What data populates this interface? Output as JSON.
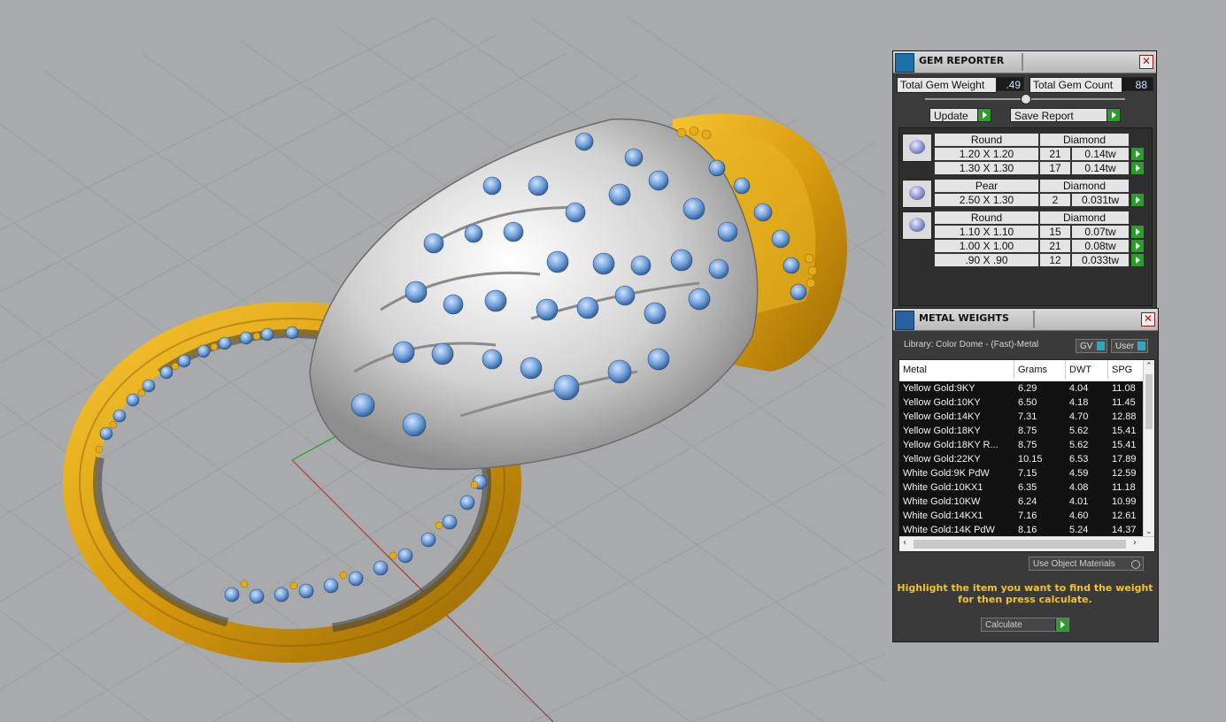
{
  "gem_reporter": {
    "title": "GEM REPORTER",
    "total_gem_weight_label": "Total Gem Weight",
    "total_gem_weight_value": ".49",
    "total_gem_count_label": "Total Gem Count",
    "total_gem_count_value": "88",
    "update_label": "Update",
    "save_report_label": "Save Report",
    "groups": [
      {
        "shape": "Round",
        "material": "Diamond",
        "rows": [
          {
            "size": "1.20 X 1.20",
            "count": "21",
            "weight": "0.14tw"
          },
          {
            "size": "1.30 X 1.30",
            "count": "17",
            "weight": "0.14tw"
          }
        ]
      },
      {
        "shape": "Pear",
        "material": "Diamond",
        "rows": [
          {
            "size": "2.50 X 1.30",
            "count": "2",
            "weight": "0.031tw"
          }
        ]
      },
      {
        "shape": "Round",
        "material": "Diamond",
        "rows": [
          {
            "size": "1.10 X 1.10",
            "count": "15",
            "weight": "0.07tw"
          },
          {
            "size": "1.00 X 1.00",
            "count": "21",
            "weight": "0.08tw"
          },
          {
            "size": ".90 X .90",
            "count": "12",
            "weight": "0.033tw"
          }
        ]
      }
    ]
  },
  "metal_weights": {
    "title": "METAL WEIGHTS",
    "library_label": "Library: Color Dome - (Fast)-Metal",
    "gv_label": "GV",
    "user_label": "User",
    "columns": [
      "Metal",
      "Grams",
      "DWT",
      "SPG"
    ],
    "rows": [
      [
        "Yellow Gold:9KY",
        "6.29",
        "4.04",
        "11.08"
      ],
      [
        "Yellow Gold:10KY",
        "6.50",
        "4.18",
        "11.45"
      ],
      [
        "Yellow Gold:14KY",
        "7.31",
        "4.70",
        "12.88"
      ],
      [
        "Yellow Gold:18KY",
        "8.75",
        "5.62",
        "15.41"
      ],
      [
        "Yellow Gold:18KY R...",
        "8.75",
        "5.62",
        "15.41"
      ],
      [
        "Yellow Gold:22KY",
        "10.15",
        "6.53",
        "17.89"
      ],
      [
        "White Gold:9K PdW",
        "7.15",
        "4.59",
        "12.59"
      ],
      [
        "White Gold:10KX1",
        "6.35",
        "4.08",
        "11.18"
      ],
      [
        "White Gold:10KW",
        "6.24",
        "4.01",
        "10.99"
      ],
      [
        "White Gold:14KX1",
        "7.16",
        "4.60",
        "12.61"
      ],
      [
        "White Gold:14K PdW",
        "8.16",
        "5.24",
        "14.37"
      ]
    ],
    "use_object_materials_label": "Use Object Materials",
    "instruction_line1": "Highlight the item you want to find the weight",
    "instruction_line2": "for then press calculate.",
    "calculate_label": "Calculate"
  },
  "colors": {
    "gold": "#d9a013",
    "silver": "#d6d6d6",
    "gem_blue": "#6f9fd8",
    "panel_bg": "#3b3b3b",
    "instruction_text": "#f2c230"
  }
}
